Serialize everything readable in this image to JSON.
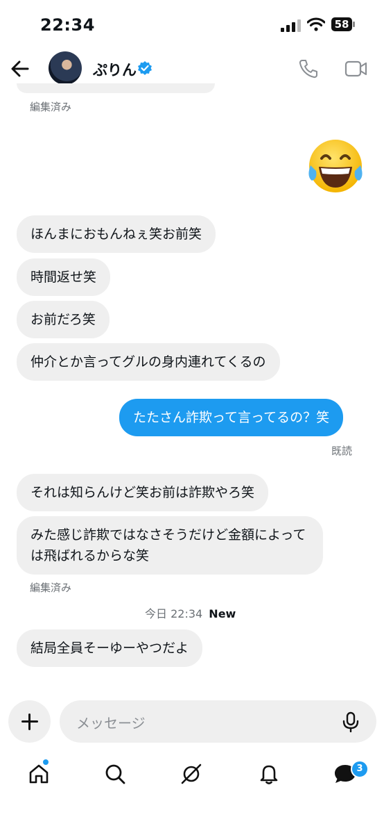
{
  "status_bar": {
    "time": "22:34",
    "battery": "58"
  },
  "header": {
    "contact_name": "ぷりん"
  },
  "messages": {
    "edited_label_1": "編集済み",
    "received_1": "ほんまにおもんねぇ笑お前笑",
    "received_2": "時間返せ笑",
    "received_3": "お前だろ笑",
    "received_4": "仲介とか言ってグルの身内連れてくるの",
    "sent_1": "たたさん詐欺って言ってるの？笑",
    "read_label": "既読",
    "received_5": "それは知らんけど笑お前は詐欺やろ笑",
    "received_6": "みた感じ詐欺ではなさそうだけど金額によっては飛ばれるからな笑",
    "edited_label_2": "編集済み",
    "timestamp": "今日 22:34",
    "new_label": "New",
    "received_7": "結局全員そーゆーやつだよ"
  },
  "composer": {
    "placeholder": "メッセージ"
  },
  "bottom_nav": {
    "messages_badge": "3"
  },
  "colors": {
    "accent": "#1d9bf0",
    "bubble_received": "#efefef"
  }
}
